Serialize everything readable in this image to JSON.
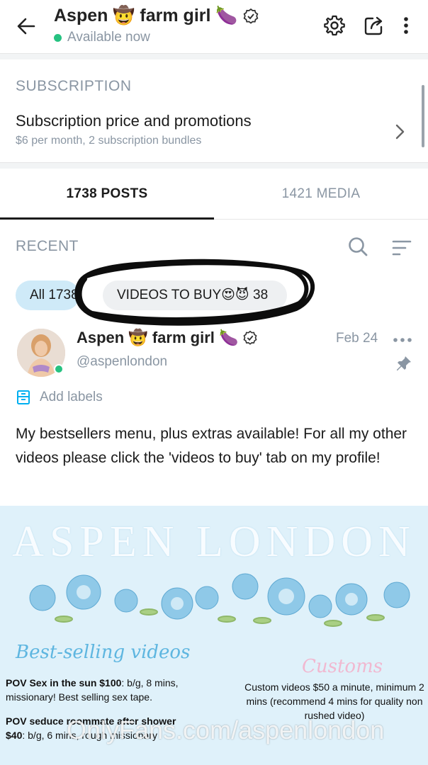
{
  "header": {
    "title": "Aspen 🤠 farm girl 🍆",
    "status": "Available now"
  },
  "subscription": {
    "heading": "SUBSCRIPTION",
    "title": "Subscription price and promotions",
    "detail": "$6 per month, 2 subscription bundles"
  },
  "tabs": [
    {
      "label": "1738 POSTS",
      "active": true
    },
    {
      "label": "1421 MEDIA",
      "active": false
    }
  ],
  "recent": {
    "label": "RECENT",
    "chips": [
      {
        "label": "All 1738"
      },
      {
        "label": "VIDEOS TO BUY😍😈 38"
      }
    ]
  },
  "post": {
    "author": "Aspen 🤠 farm girl 🍆",
    "handle": "@aspenlondon",
    "date": "Feb 24",
    "add_labels": "Add labels",
    "text": "My bestsellers menu, plus extras available! For all my other videos please click the 'videos to buy' tab on my profile!",
    "image": {
      "title": "ASPEN LONDON",
      "best_title": "Best-selling videos",
      "customs_title": "Customs",
      "item1_name": "POV Sex in the sun $100",
      "item1_desc": ": b/g, 8 mins, missionary! Best selling sex tape.",
      "item2_name": "POV seduce roommate after shower",
      "item2_price": "$40",
      "item2_desc": ": b/g, 6 mins, rough missionary",
      "customs_text": "Custom videos $50 a minute, minimum 2 mins (recommend 4 mins for quality non rushed video)",
      "watermark": "OnlyFans.com/aspenlondon"
    }
  },
  "colors": {
    "online": "#26c281",
    "muted": "#8a96a3",
    "chip_active": "#cfeaf8"
  }
}
